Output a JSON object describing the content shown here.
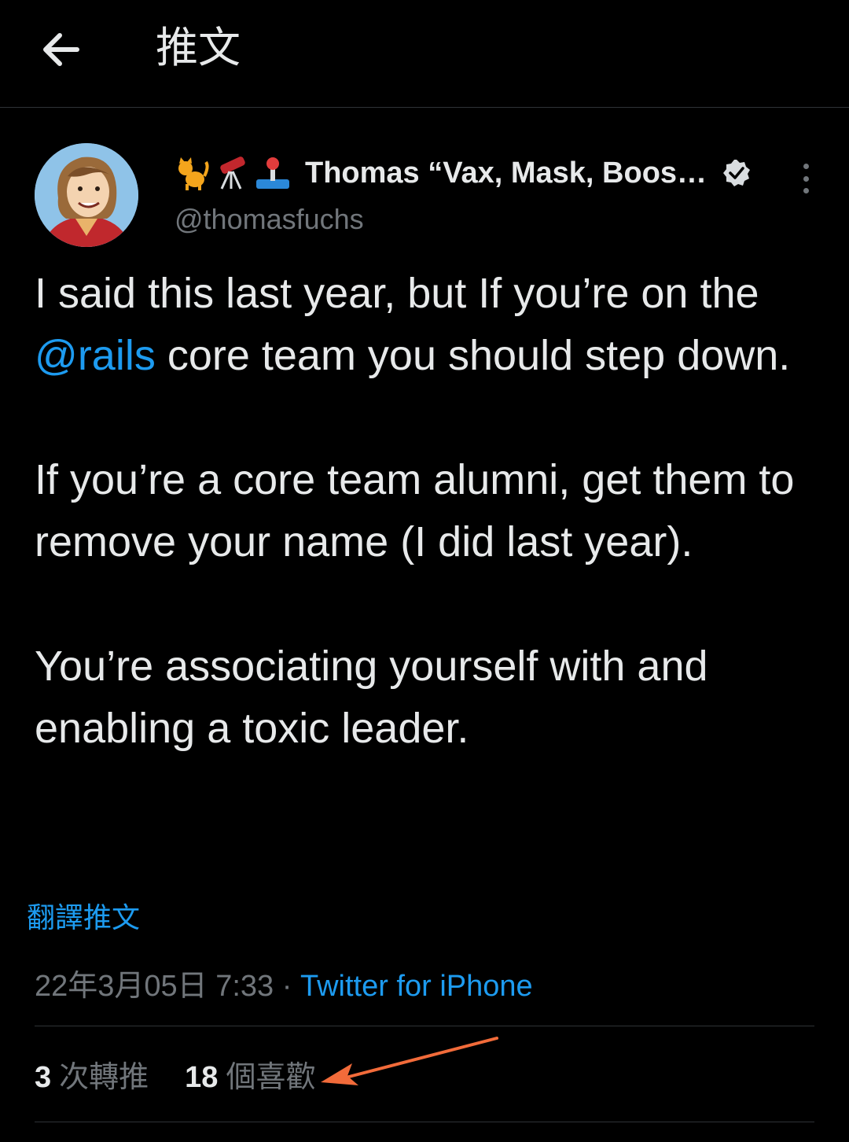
{
  "header": {
    "title": "推文",
    "back_icon": "arrow-left-icon"
  },
  "author": {
    "emojis": [
      "cat-emoji",
      "telescope-emoji",
      "joystick-emoji"
    ],
    "display_name": "Thomas “Vax, Mask, Boos…",
    "handle": "@thomasfuchs",
    "verified_icon": "verified-badge-icon",
    "more_icon": "more-vertical-icon"
  },
  "tweet": {
    "p1_before": "I said this last year, but If you’re on the ",
    "p1_mention": "@rails",
    "p1_after": " core team you should step down.",
    "p2": "If you’re a core team alumni, get them to remove your name (I did last year).",
    "p3": "You’re associating yourself with and enabling a toxic leader."
  },
  "translate_label": "翻譯推文",
  "meta": {
    "timestamp": "22年3月05日 7:33",
    "separator": " · ",
    "source": "Twitter for iPhone"
  },
  "stats": {
    "retweets_count": "3",
    "retweets_label": "次轉推",
    "likes_count": "18",
    "likes_label": "個喜歡"
  },
  "colors": {
    "background": "#000000",
    "text": "#e7e9ea",
    "muted": "#71767b",
    "link": "#1d9bf0",
    "annotation_arrow": "#f26b3a"
  }
}
